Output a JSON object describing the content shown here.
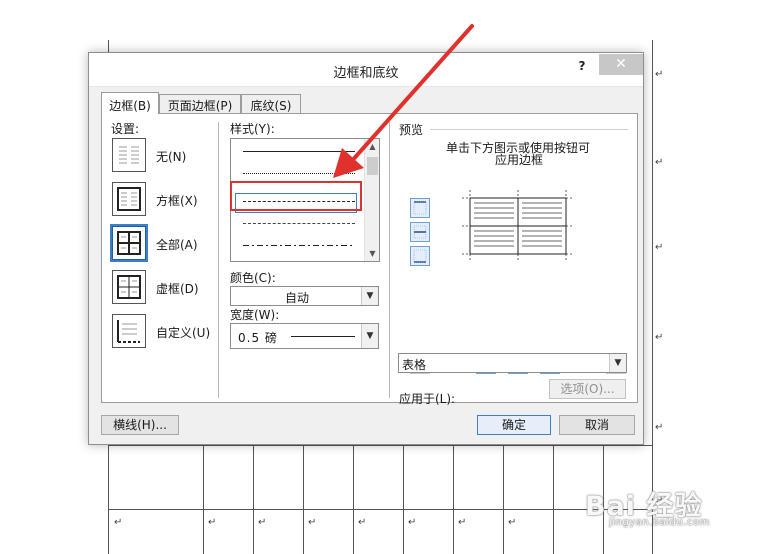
{
  "dialog": {
    "title": "边框和底纹",
    "help": "?",
    "close": "✕"
  },
  "tabs": [
    {
      "label": "边框(B)",
      "active": true
    },
    {
      "label": "页面边框(P)",
      "active": false
    },
    {
      "label": "底纹(S)",
      "active": false
    }
  ],
  "settings": {
    "heading": "设置:",
    "items": [
      {
        "label": "无(N)",
        "selected": false
      },
      {
        "label": "方框(X)",
        "selected": false
      },
      {
        "label": "全部(A)",
        "selected": true
      },
      {
        "label": "虚框(D)",
        "selected": false
      },
      {
        "label": "自定义(U)",
        "selected": false
      }
    ]
  },
  "style": {
    "heading": "样式(Y):",
    "selected_index": 2
  },
  "color": {
    "label": "颜色(C):",
    "value": "自动"
  },
  "width": {
    "label": "宽度(W):",
    "value": "0.5 磅"
  },
  "preview": {
    "heading": "预览",
    "hint_line1": "单击下方图示或使用按钮可",
    "hint_line2": "应用边框"
  },
  "apply_to": {
    "label": "应用于(L):",
    "value": "表格"
  },
  "buttons": {
    "options": "选项(O)...",
    "horizontal_line": "横线(H)...",
    "ok": "确定",
    "cancel": "取消"
  },
  "watermark": {
    "main": "Bai 经验",
    "sub": "jingyan.baidu.com"
  },
  "colors": {
    "accent": "#3c7fc6",
    "highlight": "#e0322d",
    "arrow": "#e0322d"
  }
}
